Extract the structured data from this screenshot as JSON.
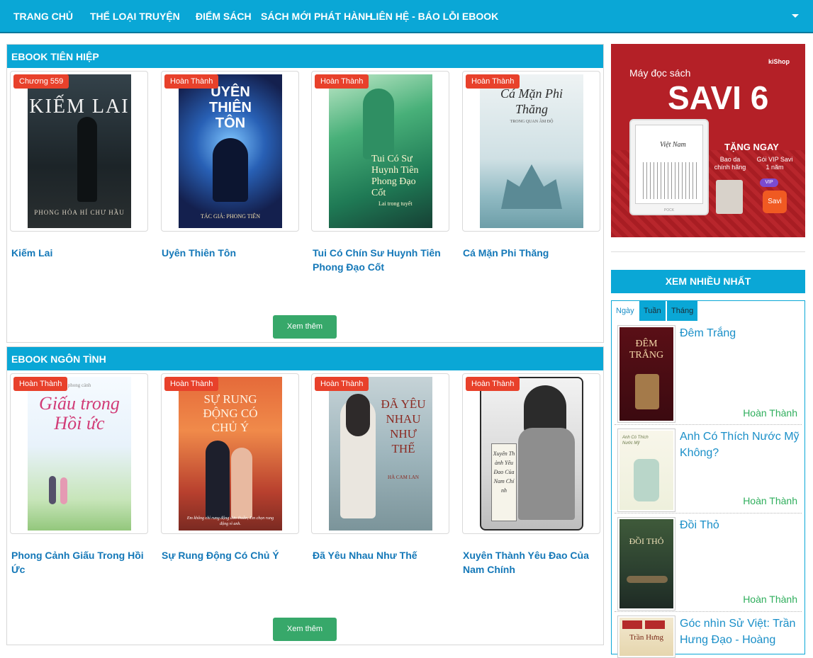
{
  "nav": {
    "items": [
      "TRANG CHỦ",
      "THỂ LOẠI TRUYỆN",
      "ĐIỂM SÁCH",
      "SÁCH MỚI PHÁT HÀNH",
      "LIÊN HỆ - BÁO LỖI EBOOK"
    ]
  },
  "sections": [
    {
      "heading": "EBOOK TIÊN HIỆP",
      "more_label": "Xem thêm",
      "books": [
        {
          "badge": "Chương 559",
          "title": "Kiếm Lai",
          "cover_text": "KIẾM LAI",
          "cover_sub": "PHONG HỎA HÍ CHƯ HẦU"
        },
        {
          "badge": "Hoàn Thành",
          "title": "Uyên Thiên Tôn",
          "cover_text": "UYÊN THIÊN TÔN",
          "cover_sub": "TÁC GIẢ: PHONG TIÊN"
        },
        {
          "badge": "Hoàn Thành",
          "title": "Tui Có Chín Sư Huynh Tiên Phong Đạo Cốt",
          "cover_text": "Tui Có Sư Huynh Tiên Phong Đạo Cốt",
          "cover_sub": "Lai trong tuyết"
        },
        {
          "badge": "Hoàn Thành",
          "title": "Cá Mặn Phi Thăng",
          "cover_text": "Cá Mặn Phi Thăng",
          "cover_sub": "TRONG QUAN ÂM ĐỘ"
        }
      ]
    },
    {
      "heading": "EBOOK NGÔN TÌNH",
      "more_label": "Xem thêm",
      "books": [
        {
          "badge": "Hoàn Thành",
          "title": "Phong Cảnh Giấu Trong Hồi Ức",
          "cover_text": "Giấu trong Hồi ức",
          "cover_sub": "phong cảnh"
        },
        {
          "badge": "Hoàn Thành",
          "title": "Sự Rung Động Có Chủ Ý",
          "cover_text": "SỰ RUNG ĐỘNG CÓ CHỦ Ý",
          "cover_sub": "Em không chỉ rung động đơn thuần, Em chọn rung động vì anh."
        },
        {
          "badge": "Hoàn Thành",
          "title": "Đã Yêu Nhau Như Thế",
          "cover_text": "ĐÃ YÊU NHAU NHƯ THẾ",
          "cover_sub": "HÀ CAM LAN"
        },
        {
          "badge": "Hoàn Thành",
          "title": "Xuyên Thành Yêu Đao Của Nam Chính",
          "cover_text": "Xuyên Thành Yêu Đao Của Nam Chính",
          "cover_sub": ""
        }
      ]
    }
  ],
  "ad": {
    "brand": "kiShop",
    "line1": "Máy đọc sách",
    "product": "SAVI 6",
    "gift_title": "TẶNG NGAY",
    "gift1": "Bao da chính hãng",
    "gift2": "Gói VIP Savi 1 năm",
    "vip": "VIP",
    "logo": "Savi",
    "screen_text": "Việt Nam",
    "device_brand": "POCK"
  },
  "sidebar": {
    "heading": "XEM NHIỀU NHẤT",
    "tabs": [
      "Ngày",
      "Tuần",
      "Tháng"
    ],
    "items": [
      {
        "title": "Đêm Trắng",
        "status": "Hoàn Thành",
        "cover_text": "ĐÊM TRẮNG"
      },
      {
        "title": "Anh Có Thích Nước Mỹ Không?",
        "status": "Hoàn Thành",
        "cover_text": "Anh Có Thích Nước Mỹ"
      },
      {
        "title": "Đồi Thỏ",
        "status": "Hoàn Thành",
        "cover_text": "ĐỒI THỎ"
      },
      {
        "title": "Góc nhìn Sử Việt: Trần Hưng Đạo - Hoàng",
        "status": "",
        "cover_text": "Trần Hưng"
      }
    ]
  },
  "colors": {
    "accent": "#0aa7d6",
    "badge": "#e8412b",
    "button": "#37a86a",
    "title": "#1478b8",
    "status": "#2fae5c"
  }
}
